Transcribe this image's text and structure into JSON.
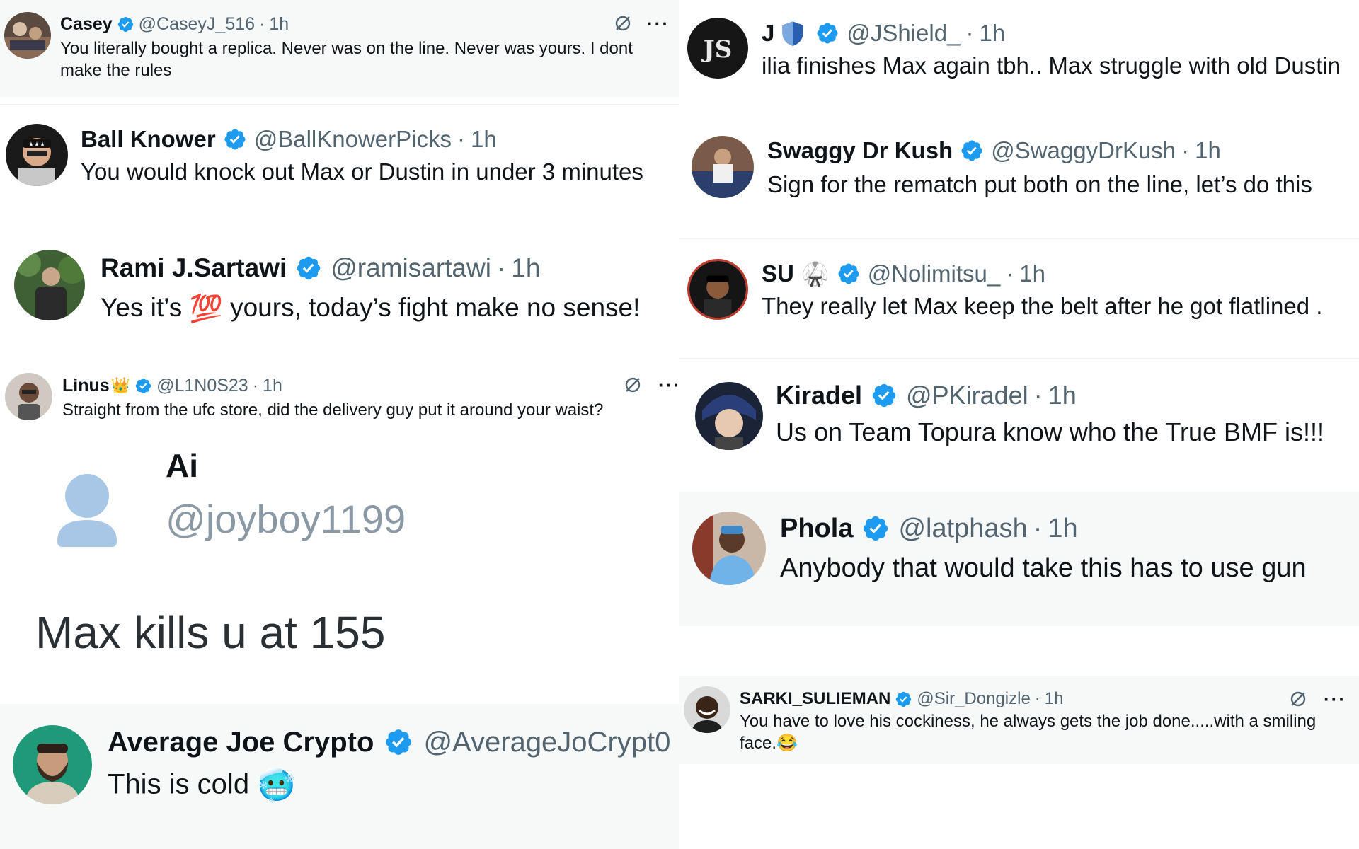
{
  "colors": {
    "verified_badge": "#1d9bf0",
    "handle_grey": "#536471",
    "text_dark": "#0f1419",
    "tile_grey": "#f7f8f8",
    "divider": "#eff1f3"
  },
  "icons": {
    "verified": "verified-badge-icon",
    "grok": "grok-slash-icon",
    "more": "more-dots-icon",
    "default_avatar": "default-avatar-icon"
  },
  "left": {
    "casey": {
      "name": "Casey",
      "handle": "@CaseyJ_516",
      "dot": "·",
      "time": "1h",
      "text": "You literally bought a replica. Never was on the line. Never was yours. I dont make the rules",
      "more": "···"
    },
    "ball_knower": {
      "name": "Ball Knower",
      "handle": "@BallKnowerPicks",
      "dot": "·",
      "time": "1h",
      "text": "You would knock out Max or Dustin in under 3 minutes"
    },
    "rami": {
      "name": "Rami J.Sartawi",
      "handle": "@ramisartawi",
      "dot": "·",
      "time": "1h",
      "text_before": "Yes it’s",
      "emoji": "💯",
      "text_after": "yours, today’s fight make no sense!"
    },
    "linus": {
      "name": "Linus",
      "name_emoji": "👑",
      "handle": "@L1N0S23",
      "dot": "·",
      "time": "1h",
      "text": "Straight from the ufc store, did the delivery guy put it around your waist?",
      "more": "···",
      "quote": {
        "name": "Ai",
        "handle": "@joyboy1199",
        "text": "Max kills u at 155"
      }
    },
    "average_joe": {
      "name": "Average Joe Crypto",
      "handle": "@AverageJoCrypt0",
      "text_before": "This is cold",
      "emoji": "🥶"
    }
  },
  "right": {
    "jshield": {
      "name": "J",
      "handle": "@JShield_",
      "dot": "·",
      "time": "1h",
      "text": "ilia finishes Max again tbh.. Max struggle with old Dustin"
    },
    "swaggy": {
      "name": "Swaggy Dr Kush",
      "handle": "@SwaggyDrKush",
      "dot": "·",
      "time": "1h",
      "text": "Sign for the rematch put both on the line, let’s do this"
    },
    "su": {
      "name": "SU",
      "name_emoji": "🥋",
      "handle": "@Nolimitsu_",
      "dot": "·",
      "time": "1h",
      "text": "They really let Max keep the belt after he got flatlined ."
    },
    "kiradel": {
      "name": "Kiradel",
      "handle": "@PKiradel",
      "dot": "·",
      "time": "1h",
      "text": "Us on Team Topura know who the True BMF is!!!"
    },
    "phola": {
      "name": "Phola",
      "handle": "@latphash",
      "dot": "·",
      "time": "1h",
      "text": "Anybody that would take this has to use gun"
    },
    "sarki": {
      "name": "SARKI_SULIEMAN",
      "handle": "@Sir_Dongizle",
      "dot": "·",
      "time": "1h",
      "text": "You have to love his cockiness, he always gets the job done.....with a smiling face.",
      "emoji": "😂",
      "more": "···"
    }
  }
}
